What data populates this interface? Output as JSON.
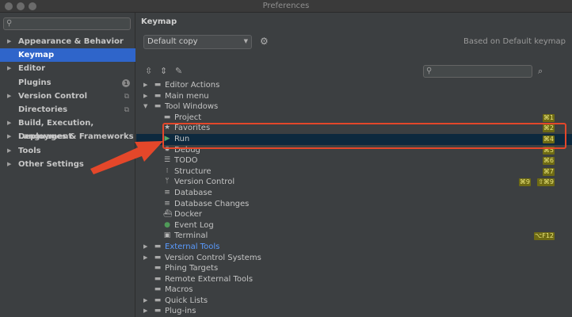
{
  "window": {
    "title": "Preferences"
  },
  "sidebar": {
    "search_placeholder": "",
    "items": [
      {
        "label": "Appearance & Behavior",
        "arrow": "▶",
        "selected": false
      },
      {
        "label": "Keymap",
        "arrow": "",
        "selected": true
      },
      {
        "label": "Editor",
        "arrow": "▶",
        "selected": false
      },
      {
        "label": "Plugins",
        "arrow": "",
        "badge": "1",
        "selected": false
      },
      {
        "label": "Version Control",
        "arrow": "▶",
        "selected": false
      },
      {
        "label": "Directories",
        "arrow": "",
        "selected": false
      },
      {
        "label": "Build, Execution, Deployment",
        "arrow": "▶",
        "selected": false
      },
      {
        "label": "Languages & Frameworks",
        "arrow": "▶",
        "selected": false
      },
      {
        "label": "Tools",
        "arrow": "▶",
        "selected": false
      },
      {
        "label": "Other Settings",
        "arrow": "▶",
        "selected": false
      }
    ]
  },
  "main": {
    "heading": "Keymap",
    "keymap_select": "Default copy",
    "based_on": "Based on Default keymap",
    "search_placeholder": ""
  },
  "tree": [
    {
      "label": "Editor Actions",
      "level": 0,
      "arrow": "▶",
      "icon": "folder"
    },
    {
      "label": "Main menu",
      "level": 0,
      "arrow": "▶",
      "icon": "folder"
    },
    {
      "label": "Tool Windows",
      "level": 0,
      "arrow": "▼",
      "icon": "folder"
    },
    {
      "label": "Project",
      "level": 1,
      "icon": "folder",
      "shortcuts": [
        "⌘1"
      ]
    },
    {
      "label": "Favorites",
      "level": 1,
      "icon": "star",
      "shortcuts": [
        "⌘2"
      ]
    },
    {
      "label": "Run",
      "level": 1,
      "icon": "run",
      "shortcuts": [
        "⌘4"
      ],
      "selected": true
    },
    {
      "label": "Debug",
      "level": 1,
      "icon": "bug",
      "shortcuts": [
        "⌘5"
      ]
    },
    {
      "label": "TODO",
      "level": 1,
      "icon": "list",
      "shortcuts": [
        "⌘6"
      ]
    },
    {
      "label": "Structure",
      "level": 1,
      "icon": "structure",
      "shortcuts": [
        "⌘7"
      ]
    },
    {
      "label": "Version Control",
      "level": 1,
      "icon": "vcs",
      "shortcuts": [
        "⌘9",
        "⇧⌘9"
      ]
    },
    {
      "label": "Database",
      "level": 1,
      "icon": "database"
    },
    {
      "label": "Database Changes",
      "level": 1,
      "icon": "database"
    },
    {
      "label": "Docker",
      "level": 1,
      "icon": "docker"
    },
    {
      "label": "Event Log",
      "level": 1,
      "icon": "event"
    },
    {
      "label": "Terminal",
      "level": 1,
      "icon": "terminal",
      "shortcuts": [
        "⌥F12"
      ]
    },
    {
      "label": "External Tools",
      "level": 0,
      "arrow": "▶",
      "icon": "folder",
      "link": true
    },
    {
      "label": "Version Control Systems",
      "level": 0,
      "arrow": "▶",
      "icon": "folder"
    },
    {
      "label": "Phing Targets",
      "level": 0,
      "arrow": "",
      "icon": "folder"
    },
    {
      "label": "Remote External Tools",
      "level": 0,
      "arrow": "",
      "icon": "folder"
    },
    {
      "label": "Macros",
      "level": 0,
      "arrow": "",
      "icon": "folder"
    },
    {
      "label": "Quick Lists",
      "level": 0,
      "arrow": "▶",
      "icon": "folder"
    },
    {
      "label": "Plug-ins",
      "level": 0,
      "arrow": "▶",
      "icon": "folder"
    }
  ],
  "colors": {
    "selection_sidebar": "#2f65ca",
    "selection_tree": "#0d293e",
    "shortcut_bg": "#6e6a14",
    "shortcut_fg": "#e9e57a",
    "annotation": "#e4472a",
    "link": "#5a9bff"
  }
}
